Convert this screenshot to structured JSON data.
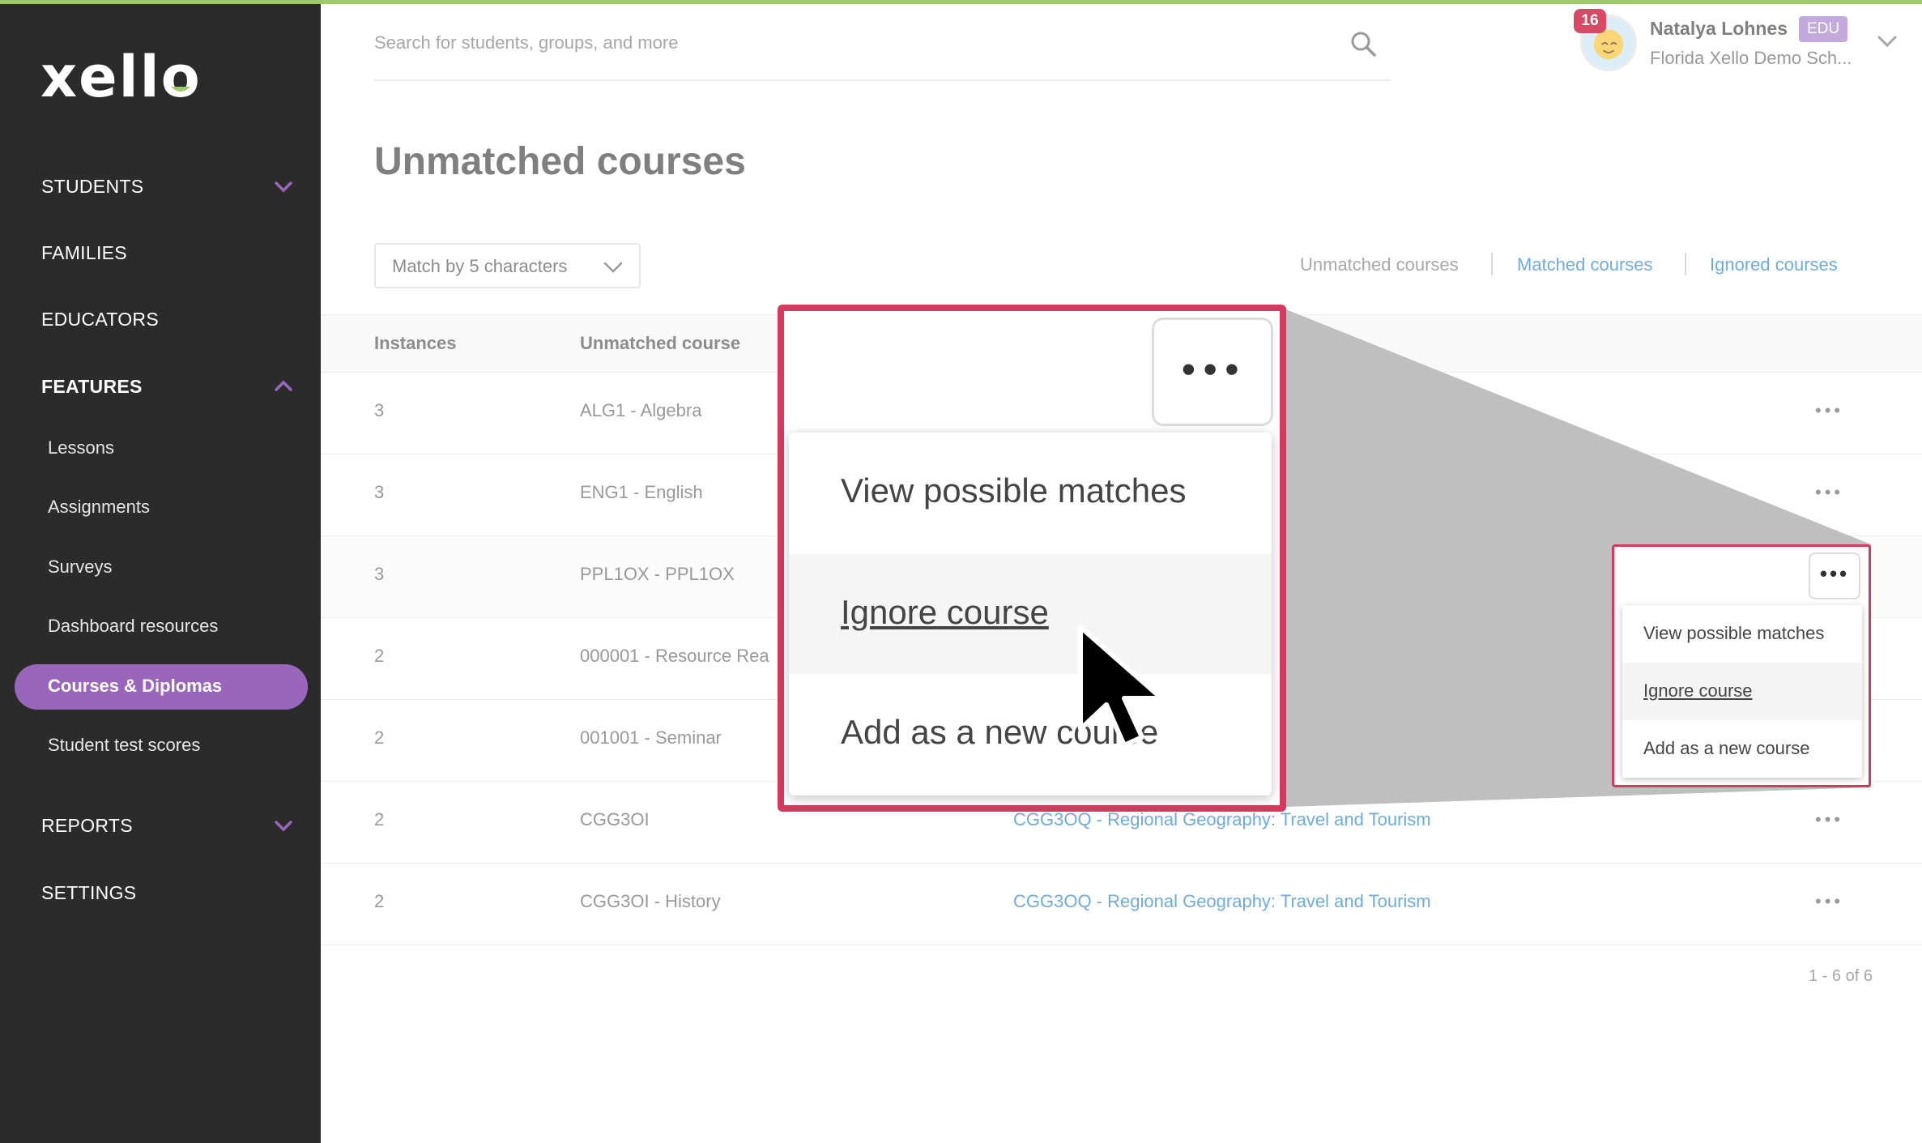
{
  "app": {
    "logo_text": "xello"
  },
  "sidebar": {
    "items": [
      {
        "label": "STUDENTS",
        "expanded": false
      },
      {
        "label": "FAMILIES"
      },
      {
        "label": "EDUCATORS"
      },
      {
        "label": "FEATURES",
        "expanded": true
      },
      {
        "label": "Lessons"
      },
      {
        "label": "Assignments"
      },
      {
        "label": "Surveys"
      },
      {
        "label": "Dashboard resources"
      },
      {
        "label": "Courses & Diplomas",
        "active": true
      },
      {
        "label": "Student test scores"
      },
      {
        "label": "REPORTS",
        "expanded": false
      },
      {
        "label": "SETTINGS"
      }
    ]
  },
  "search": {
    "placeholder": "Search for students, groups, and more"
  },
  "user": {
    "notifications": "16",
    "name": "Natalya Lohnes",
    "tag": "EDU",
    "school": "Florida Xello Demo Sch..."
  },
  "page": {
    "title": "Unmatched courses",
    "match_select": "Match by 5 characters",
    "tabs": [
      {
        "label": "Unmatched courses",
        "active": true
      },
      {
        "label": "Matched courses"
      },
      {
        "label": "Ignored courses"
      }
    ]
  },
  "table": {
    "headers": {
      "instances": "Instances",
      "course": "Unmatched course"
    },
    "rows": [
      {
        "instances": "3",
        "course": "ALG1 - Algebra",
        "match": ""
      },
      {
        "instances": "3",
        "course": "ENG1 - English",
        "match": ""
      },
      {
        "instances": "3",
        "course": "PPL1OX - PPL1OX",
        "match": ""
      },
      {
        "instances": "2",
        "course": "000001 - Resource Rea",
        "match": ""
      },
      {
        "instances": "2",
        "course": "001001 - Seminar",
        "match": ""
      },
      {
        "instances": "2",
        "course": "CGG3OI",
        "match": "CGG3OQ - Regional Geography: Travel and Tourism"
      },
      {
        "instances": "2",
        "course": "CGG3OI - History",
        "match": "CGG3OQ - Regional Geography: Travel and Tourism"
      }
    ],
    "row_action": "•••",
    "pagination": "1 - 6 of 6"
  },
  "context_menu": {
    "button": "•••",
    "items": [
      "View possible matches",
      "Ignore course",
      "Add as a new course"
    ],
    "highlighted_index": 1
  },
  "colors": {
    "sidebar_bg": "#2b2b2b",
    "active_pill": "#9966bb",
    "link": "#3e8fd6",
    "highlight_frame": "#d43a5e",
    "accent_green": "#9ccc65"
  }
}
